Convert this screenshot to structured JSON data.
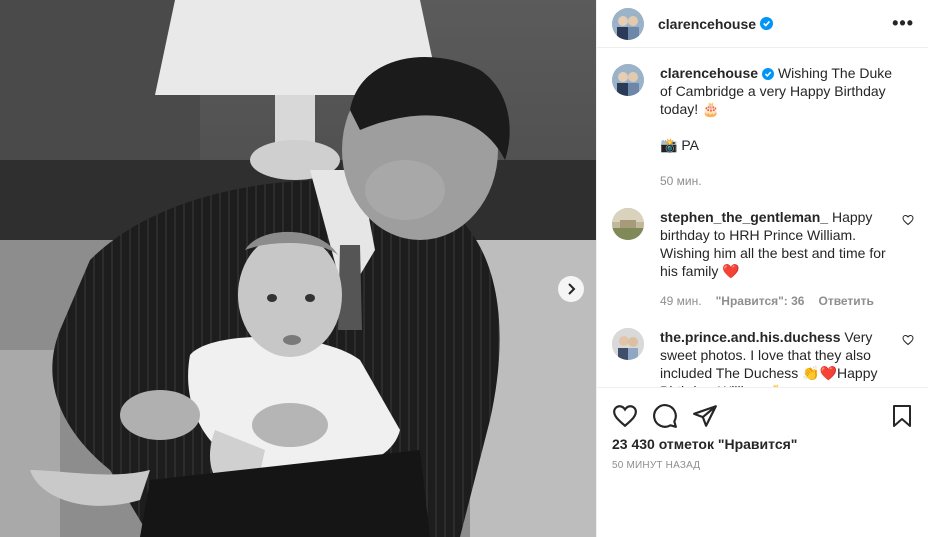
{
  "post": {
    "username": "clarencehouse",
    "more_label": "•••",
    "caption_text": "Wishing The Duke of Cambridge a very Happy Birthday today! 🎂",
    "caption_credit": "📸 PA",
    "caption_time": "50 мин."
  },
  "comments": [
    {
      "username": "stephen_the_gentleman_",
      "text": "Happy birthday to HRH Prince William. Wishing him all the best and time for his family ❤️",
      "time": "49 мин.",
      "likes": "\"Нравится\": 36",
      "reply": "Ответить"
    },
    {
      "username": "the.prince.and.his.duchess",
      "text": "Very sweet photos. I love that they also included The Duchess 👏❤️Happy Birthday, William 🎂"
    }
  ],
  "actions": {
    "likes_count": "23 430 отметок \"Нравится\"",
    "date": "50 минут назад"
  },
  "icons": {
    "like": "heart-icon",
    "comment": "comment-icon",
    "share": "share-icon",
    "save": "bookmark-icon",
    "next": "chevron-right-icon",
    "verified": "verified-badge-icon"
  },
  "colors": {
    "verified": "#0095f6",
    "secondary_text": "#8e8e8e",
    "heart_red": "#ed4956"
  }
}
